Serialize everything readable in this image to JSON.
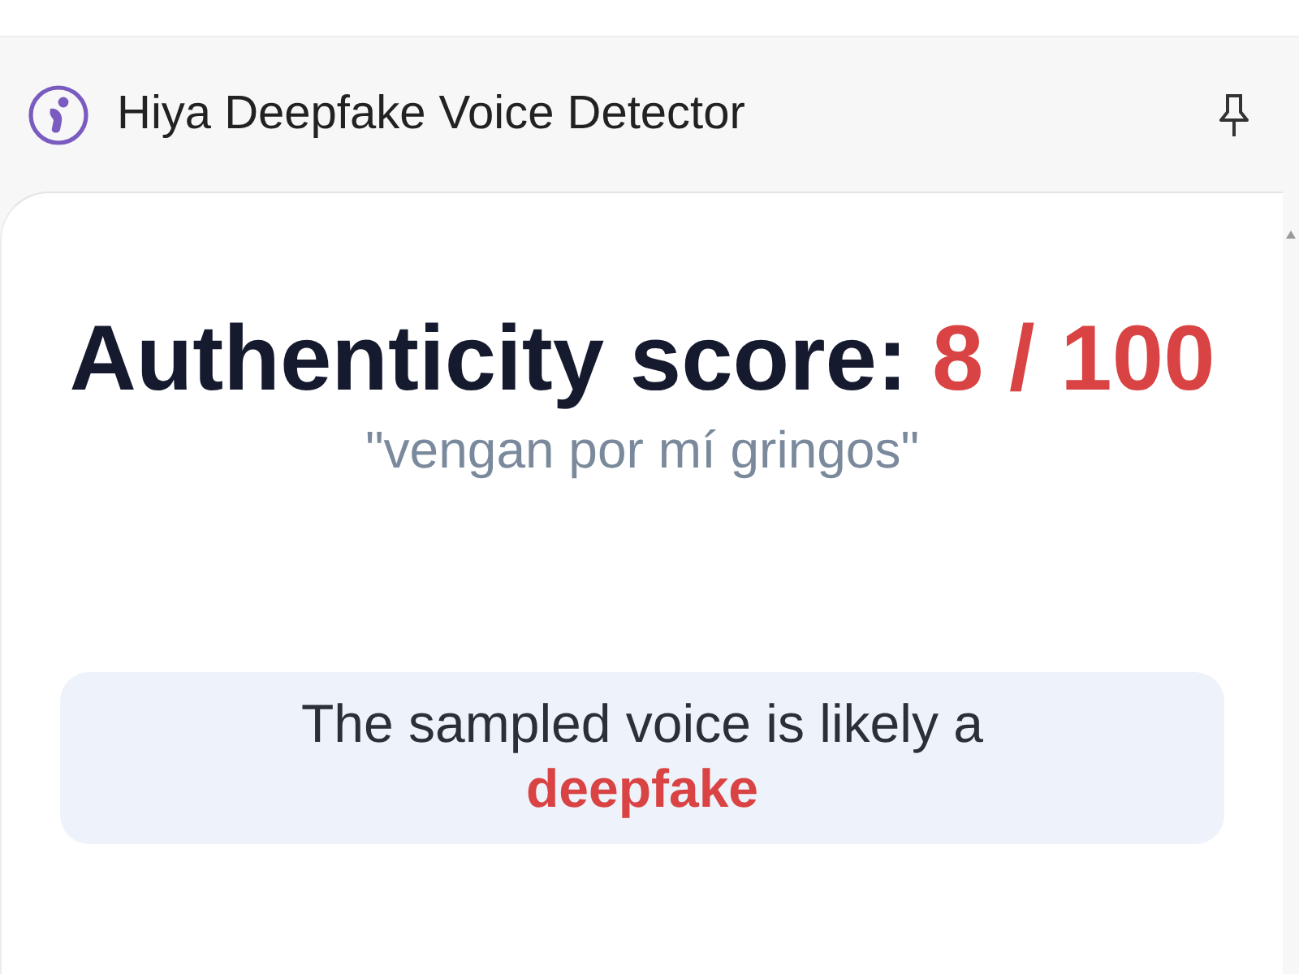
{
  "header": {
    "title": "Hiya Deepfake Voice Detector"
  },
  "score": {
    "label": "Authenticity score:",
    "value": "8 / 100",
    "quote": "\"vengan por mí gringos\""
  },
  "verdict": {
    "text": "The sampled voice is likely a **deepfake**"
  }
}
